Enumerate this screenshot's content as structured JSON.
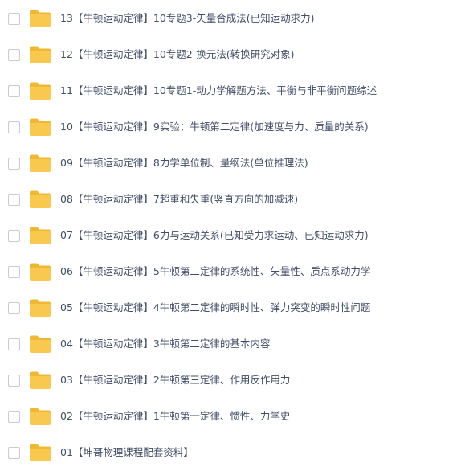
{
  "colors": {
    "folder": "#f8c94e",
    "folder_tab": "#f0b832",
    "text": "#424e67",
    "checkbox_border": "#c8cdd3"
  },
  "files": [
    {
      "name": "13【牛顿运动定律】10专题3-矢量合成法(已知运动求力)",
      "icon": "folder-icon"
    },
    {
      "name": "12【牛顿运动定律】10专题2-换元法(转换研究对象)",
      "icon": "folder-icon"
    },
    {
      "name": "11【牛顿运动定律】10专题1-动力学解题方法、平衡与非平衡问题综述",
      "icon": "folder-icon"
    },
    {
      "name": "10【牛顿运动定律】9实验：牛顿第二定律(加速度与力、质量的关系)",
      "icon": "folder-icon"
    },
    {
      "name": "09【牛顿运动定律】8力学单位制、量纲法(单位推理法)",
      "icon": "folder-icon"
    },
    {
      "name": "08【牛顿运动定律】7超重和失重(竖直方向的加减速)",
      "icon": "folder-icon"
    },
    {
      "name": "07【牛顿运动定律】6力与运动关系(已知受力求运动、已知运动求力)",
      "icon": "folder-icon"
    },
    {
      "name": "06【牛顿运动定律】5牛顿第二定律的系统性、矢量性、质点系动力学",
      "icon": "folder-icon"
    },
    {
      "name": "05【牛顿运动定律】4牛顿第二定律的瞬时性、弹力突变的瞬时性问题",
      "icon": "folder-icon"
    },
    {
      "name": "04【牛顿运动定律】3牛顿第二定律的基本内容",
      "icon": "folder-icon"
    },
    {
      "name": "03【牛顿运动定律】2牛顿第三定律、作用反作用力",
      "icon": "folder-icon"
    },
    {
      "name": "02【牛顿运动定律】1牛顿第一定律、惯性、力学史",
      "icon": "folder-icon"
    },
    {
      "name": "01【坤哥物理课程配套资料】",
      "icon": "folder-icon"
    }
  ]
}
